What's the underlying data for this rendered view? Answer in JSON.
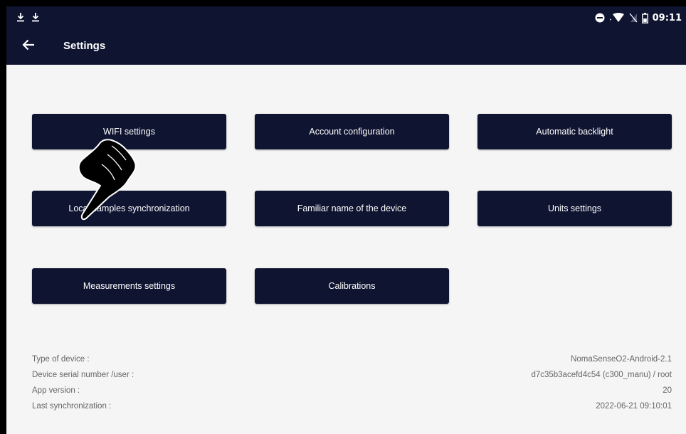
{
  "status_bar": {
    "time": "09:11",
    "left_icons": [
      "download-icon",
      "download-icon"
    ],
    "right_icons": [
      "do-not-disturb-icon",
      "wifi-icon",
      "no-sim-icon",
      "battery-icon"
    ]
  },
  "header": {
    "title": "Settings"
  },
  "buttons": {
    "wifi": "WIFI settings",
    "account": "Account configuration",
    "backlight": "Automatic backlight",
    "local_sync": "Local samples synchronization",
    "familiar_name": "Familiar name of the device",
    "units": "Units settings",
    "measurements": "Measurements settings",
    "calibrations": "Calibrations"
  },
  "device_info": [
    {
      "label": "Type of device :",
      "value": "NomaSenseO2-Android-2.1"
    },
    {
      "label": "Device serial number /user :",
      "value": "d7c35b3acefd4c54 (c300_manu) / root"
    },
    {
      "label": "App version :",
      "value": "20"
    },
    {
      "label": "Last synchronization :",
      "value": "2022-06-21 09:10:01"
    }
  ],
  "colors": {
    "primary": "#0f1431",
    "background": "#f5f5f5",
    "info_text": "#666666"
  }
}
